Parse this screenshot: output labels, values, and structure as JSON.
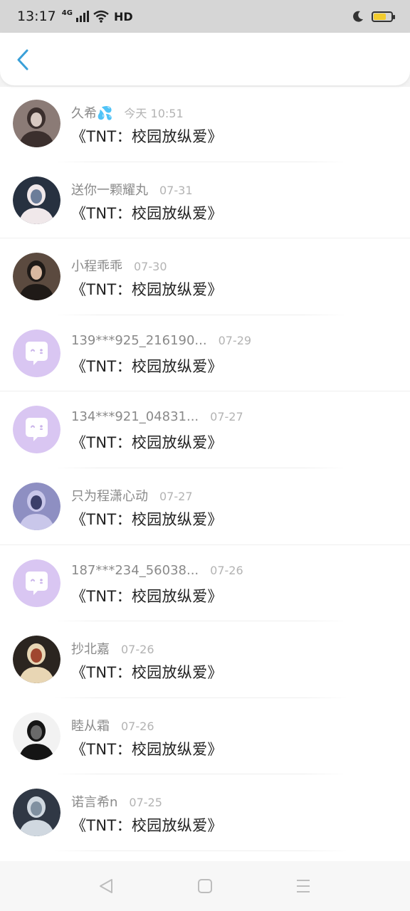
{
  "status_bar": {
    "time": "13:17",
    "network": "4G",
    "hd": "HD"
  },
  "header": {
    "back_icon": "chevron-left-icon"
  },
  "items": [
    {
      "name": "久希💦",
      "date": "今天 10:51",
      "title": "《TNT：校园放纵爱》",
      "avatar": "photo"
    },
    {
      "name": "送你一颗耀丸",
      "date": "07-31",
      "title": "《TNT：校园放纵爱》",
      "avatar": "photo"
    },
    {
      "name": "小程乖乖",
      "date": "07-30",
      "title": "《TNT：校园放纵爱》",
      "avatar": "photo"
    },
    {
      "name": "139***925_216190...",
      "date": "07-29",
      "title": "《TNT：校园放纵爱》",
      "avatar": "default"
    },
    {
      "name": "134***921_04831...",
      "date": "07-27",
      "title": "《TNT：校园放纵爱》",
      "avatar": "default"
    },
    {
      "name": "只为程潇心动",
      "date": "07-27",
      "title": "《TNT：校园放纵爱》",
      "avatar": "photo"
    },
    {
      "name": "187***234_56038...",
      "date": "07-26",
      "title": "《TNT：校园放纵爱》",
      "avatar": "default"
    },
    {
      "name": "抄北嘉",
      "date": "07-26",
      "title": "《TNT：校园放纵爱》",
      "avatar": "photo"
    },
    {
      "name": "睦从霜",
      "date": "07-26",
      "title": "《TNT：校园放纵爱》",
      "avatar": "photo"
    },
    {
      "name": "诺言希n",
      "date": "07-25",
      "title": "《TNT：校园放纵爱》",
      "avatar": "photo"
    }
  ],
  "colors": {
    "accent": "#3aa0d8",
    "default_avatar": "#d9c6f2",
    "battery": "#f2cc2e"
  }
}
